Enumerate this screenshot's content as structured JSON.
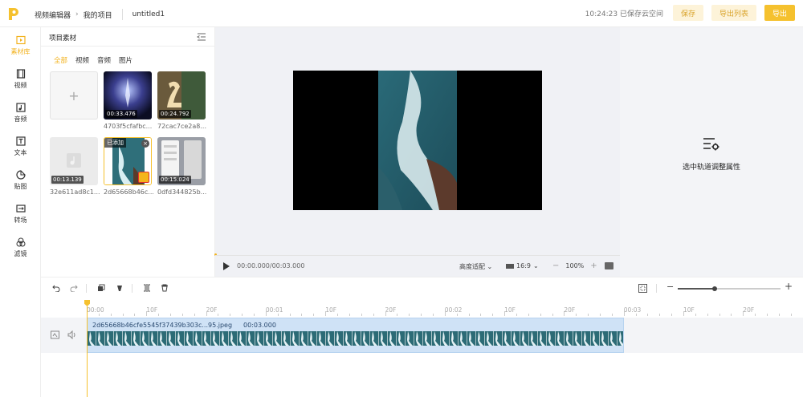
{
  "header": {
    "logo_icon": "app-logo-p",
    "breadcrumb": [
      "视频编辑器",
      "我的项目"
    ],
    "project_name": "untitled1",
    "save_status": "10:24:23 已保存云空间",
    "save_label": "保存",
    "export_list_label": "导出列表",
    "export_label": "导出",
    "accent_color": "#f5c12e"
  },
  "leftnav": {
    "items": [
      {
        "label": "素材库",
        "icon": "media-library-icon",
        "active": true
      },
      {
        "label": "视频",
        "icon": "film-icon",
        "active": false
      },
      {
        "label": "音频",
        "icon": "music-icon",
        "active": false
      },
      {
        "label": "文本",
        "icon": "text-icon",
        "active": false
      },
      {
        "label": "贴图",
        "icon": "sticker-icon",
        "active": false
      },
      {
        "label": "转场",
        "icon": "transition-icon",
        "active": false
      },
      {
        "label": "滤镜",
        "icon": "filter-icon",
        "active": false
      }
    ]
  },
  "material": {
    "title": "项目素材",
    "filters": [
      "全部",
      "视频",
      "音频",
      "图片"
    ],
    "active_filter": "全部",
    "add_label": "+",
    "items": [
      {
        "name": "4703f5cfafbc...",
        "duration": "00:33.476"
      },
      {
        "name": "72cac7ce2a8...",
        "duration": "00:24.792"
      },
      {
        "name": "32e611ad8c1...",
        "duration": "00:13.139"
      },
      {
        "name": "2d65668b46c...",
        "badge": "已添加",
        "remove": "×"
      },
      {
        "name": "0dfd344825b...",
        "duration": "00:15.024"
      }
    ]
  },
  "preview": {
    "timecode": "00:00.000/00:03.000",
    "fit_label": "高度适配",
    "ratio_label": "16:9",
    "zoom_minus": "−",
    "zoom_value": "100%",
    "zoom_plus": "+"
  },
  "properties": {
    "hint": "选中轨道调整属性",
    "icon": "track-settings-icon"
  },
  "timeline": {
    "ruler": [
      "00:00",
      "10F",
      "20F",
      "00:01",
      "10F",
      "20F",
      "00:02",
      "10F",
      "20F",
      "00:03",
      "10F",
      "20F"
    ],
    "clip_name": "2d65668b46cfe5545f37439b303c...95.jpeg",
    "clip_duration": "00:03.000",
    "zoom_minus": "−",
    "zoom_plus": "+"
  }
}
